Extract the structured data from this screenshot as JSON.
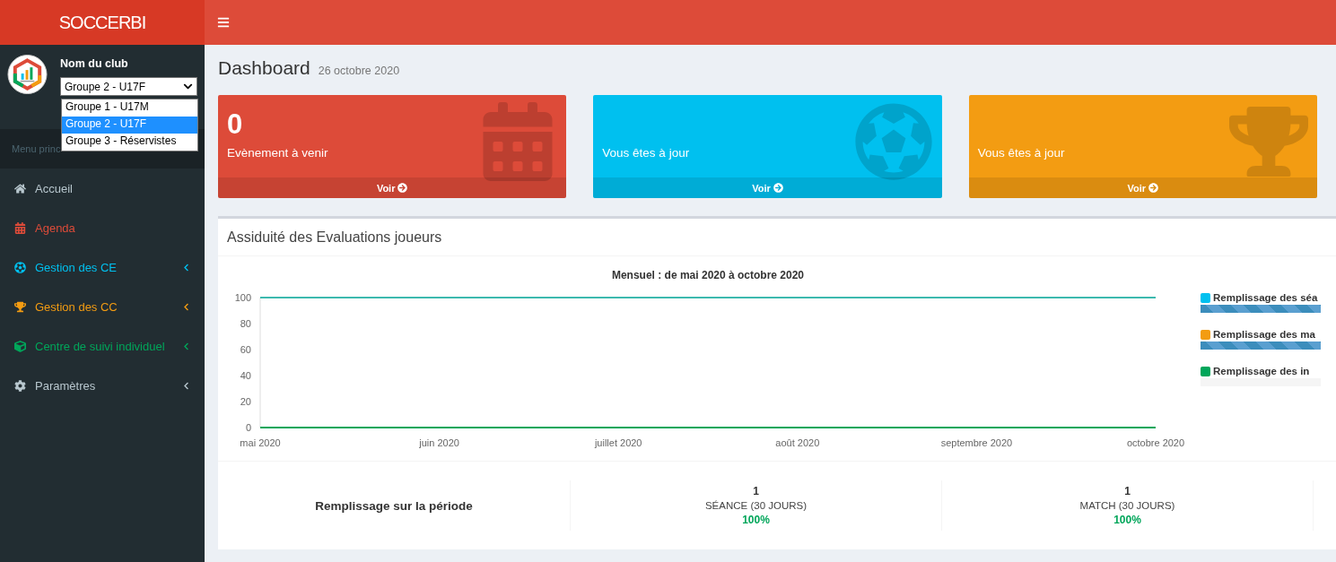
{
  "brand": "SOCCERBI",
  "club": {
    "name": "Nom du club",
    "group_select": {
      "value": "Groupe 2 - U17F",
      "options": [
        {
          "label": "Groupe 1 - U17M",
          "selected": false
        },
        {
          "label": "Groupe 2 - U17F",
          "selected": true
        },
        {
          "label": "Groupe 3 - Réservistes",
          "selected": false
        }
      ]
    }
  },
  "sidebar": {
    "header": "Menu princ",
    "items": [
      {
        "label": "Accueil",
        "kind": "home",
        "color": "#b8c7ce",
        "submenu": false
      },
      {
        "label": "Agenda",
        "kind": "calendar",
        "color": "#dd4b39",
        "submenu": false
      },
      {
        "label": "Gestion des CE",
        "kind": "ball",
        "color": "#00c0ef",
        "submenu": true
      },
      {
        "label": "Gestion des CC",
        "kind": "trophy",
        "color": "#f39c12",
        "submenu": true
      },
      {
        "label": "Centre de suivi individuel",
        "kind": "cube",
        "color": "#00a65a",
        "submenu": true
      },
      {
        "label": "Paramètres",
        "kind": "gear",
        "color": "#b8c7ce",
        "submenu": true
      }
    ]
  },
  "page": {
    "title": "Dashboard",
    "date": "26 octobre 2020"
  },
  "stat_boxes": [
    {
      "count": "0",
      "text": "Evènement à venir",
      "link": "Voir",
      "kind": "calendar",
      "color": "#dd4b39"
    },
    {
      "text": "Vous êtes à jour",
      "link": "Voir",
      "kind": "ball",
      "color": "#00c0ef"
    },
    {
      "text": "Vous êtes à jour",
      "link": "Voir",
      "kind": "trophy",
      "color": "#f39c12"
    }
  ],
  "attendance": {
    "title": "Assiduité des Evaluations joueurs",
    "chart_data": {
      "type": "line",
      "title": "Mensuel : de mai 2020 à octobre 2020",
      "categories": [
        "mai 2020",
        "juin 2020",
        "juillet 2020",
        "août 2020",
        "septembre 2020",
        "octobre 2020"
      ],
      "series": [
        {
          "color": "#3cb9ae",
          "values": [
            100,
            100,
            100,
            100,
            100,
            100
          ]
        },
        {
          "color": "#00a65a",
          "values": [
            0,
            0,
            0,
            0,
            0,
            0
          ]
        }
      ],
      "ylim": [
        0,
        100
      ],
      "yticks": [
        0,
        20,
        40,
        60,
        80,
        100
      ]
    },
    "legend": [
      {
        "label": "Remplissage des séa",
        "color": "#00c0ef",
        "level": 1
      },
      {
        "label": "Remplissage des ma",
        "color": "#f39c12",
        "level": 1
      },
      {
        "label": "Remplissage des in",
        "color": "#00a65a",
        "level": 0
      }
    ],
    "summary": {
      "label": "Remplissage sur la période",
      "items": [
        {
          "count": "1",
          "label": "SÉANCE (30 JOURS)",
          "percent": "100%"
        },
        {
          "count": "1",
          "label": "MATCH (30 JOURS)",
          "percent": "100%"
        }
      ]
    }
  }
}
